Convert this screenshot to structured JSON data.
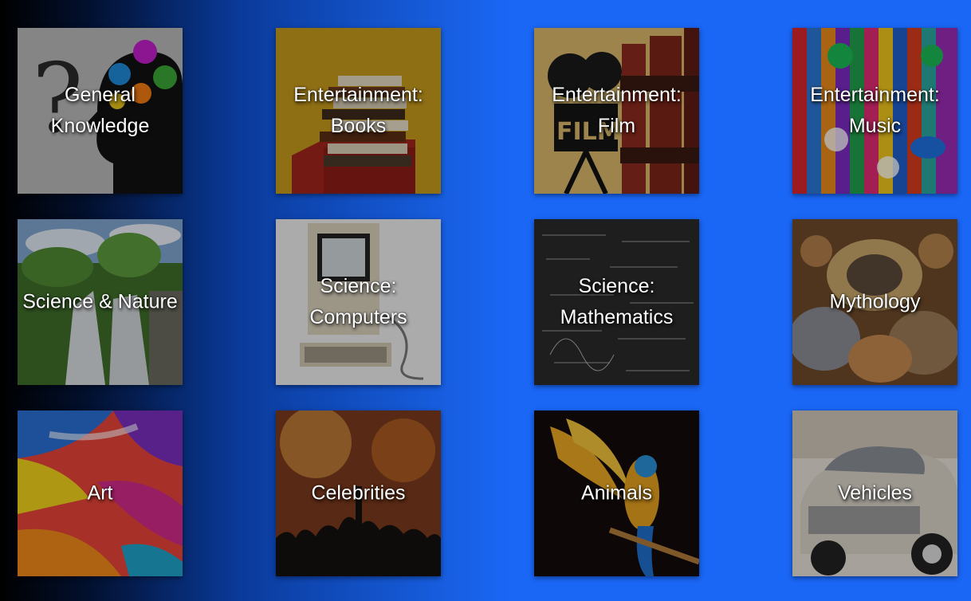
{
  "categories": [
    {
      "label": "General\nKnowledge",
      "image": "head-gears-question-mark"
    },
    {
      "label": "Entertainment:\nBooks",
      "image": "stack-of-books"
    },
    {
      "label": "Entertainment:\nFilm",
      "image": "film-camera-reels"
    },
    {
      "label": "Entertainment:\nMusic",
      "image": "colorful-music-app-logos"
    },
    {
      "label": "Science & Nature",
      "image": "waterfall-forest"
    },
    {
      "label": "Science:\nComputers",
      "image": "vintage-computer"
    },
    {
      "label": "Science:\nMathematics",
      "image": "chalkboard-equations"
    },
    {
      "label": "Mythology",
      "image": "baroque-ceiling-painting"
    },
    {
      "label": "Art",
      "image": "paint-strokes"
    },
    {
      "label": "Celebrities",
      "image": "concert-crowd"
    },
    {
      "label": "Animals",
      "image": "macaw-parrot"
    },
    {
      "label": "Vehicles",
      "image": "vintage-car"
    }
  ]
}
